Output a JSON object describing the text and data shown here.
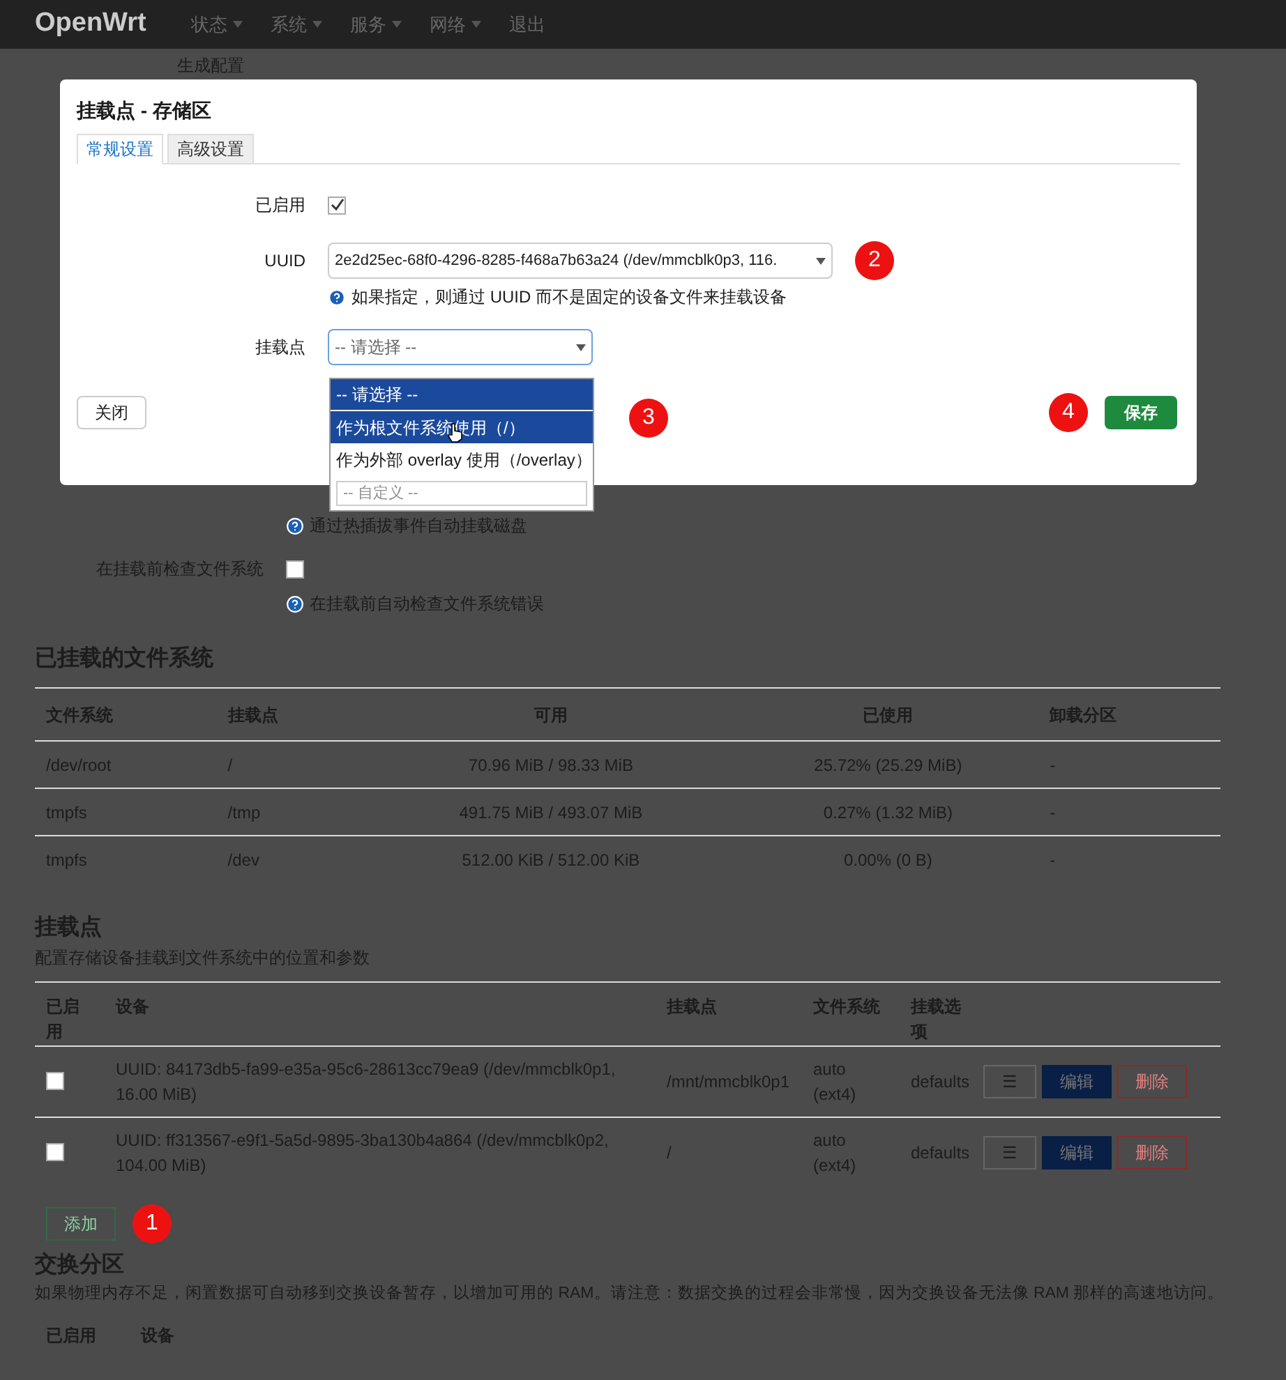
{
  "navbar": {
    "brand": "OpenWrt",
    "menus": [
      {
        "label": "状态",
        "dropdown": true
      },
      {
        "label": "系统",
        "dropdown": true
      },
      {
        "label": "服务",
        "dropdown": true
      },
      {
        "label": "网络",
        "dropdown": true
      },
      {
        "label": "退出",
        "dropdown": false
      }
    ]
  },
  "background_form": {
    "top_label": "生成配置",
    "hotplug_hint": "通过热插拔事件自动挂载磁盘",
    "check_label": "在挂载前检查文件系统",
    "check_checked": false,
    "check_hint": "在挂载前自动检查文件系统错误"
  },
  "mounted_fs": {
    "title": "已挂载的文件系统",
    "columns": [
      "文件系统",
      "挂载点",
      "可用",
      "已使用",
      "卸载分区"
    ],
    "rows": [
      [
        "/dev/root",
        "/",
        "70.96 MiB / 98.33 MiB",
        "25.72% (25.29 MiB)",
        "-"
      ],
      [
        "tmpfs",
        "/tmp",
        "491.75 MiB / 493.07 MiB",
        "0.27% (1.32 MiB)",
        "-"
      ],
      [
        "tmpfs",
        "/dev",
        "512.00 KiB / 512.00 KiB",
        "0.00% (0 B)",
        "-"
      ]
    ]
  },
  "mount_points": {
    "title": "挂载点",
    "description": "配置存储设备挂载到文件系统中的位置和参数",
    "columns": [
      "已启用",
      "设备",
      "挂载点",
      "文件系统",
      "挂载选项"
    ],
    "rows": [
      {
        "enabled": false,
        "device": "UUID: 84173db5-fa99-e35a-95c6-28613cc79ea9 (/dev/mmcblk0p1, 16.00 MiB)",
        "mount": "/mnt/mmcblk0p1",
        "fs": "auto (ext4)",
        "options": "defaults",
        "menu": "☰",
        "edit": "编辑",
        "delete": "删除"
      },
      {
        "enabled": false,
        "device": "UUID: ff313567-e9f1-5a5d-9895-3ba130b4a864 (/dev/mmcblk0p2, 104.00 MiB)",
        "mount": "/",
        "fs": "auto (ext4)",
        "options": "defaults",
        "menu": "☰",
        "edit": "编辑",
        "delete": "删除"
      }
    ],
    "add_button": "添加"
  },
  "swap": {
    "title": "交换分区",
    "description": "如果物理内存不足，闲置数据可自动移到交换设备暂存，以增加可用的 RAM。请注意：数据交换的过程会非常慢，因为交换设备无法像 RAM 那样的高速地访问。",
    "columns": [
      "已启用",
      "设备"
    ]
  },
  "modal": {
    "title": "挂载点 - 存储区",
    "tabs": [
      {
        "label": "常规设置",
        "selected": true
      },
      {
        "label": "高级设置",
        "selected": false
      }
    ],
    "enabled_label": "已启用",
    "enabled_checked": true,
    "uuid_label": "UUID",
    "uuid_value": "2e2d25ec-68f0-4296-8285-f468a7b63a24 (/dev/mmcblk0p3, 116.",
    "uuid_hint": "如果指定，则通过 UUID 而不是固定的设备文件来挂载设备",
    "mount_label": "挂载点",
    "mount_placeholder": "-- 请选择 --",
    "options": [
      {
        "kind": "option",
        "label": "-- 请选择 --",
        "selected": true,
        "hovered": false
      },
      {
        "kind": "option",
        "label": "作为根文件系统使用（/）",
        "selected": false,
        "hovered": true
      },
      {
        "kind": "option",
        "label": "作为外部 overlay 使用（/overlay）",
        "selected": false,
        "hovered": false
      },
      {
        "kind": "input",
        "placeholder": "-- 自定义 --"
      }
    ],
    "close_button": "关闭",
    "save_button": "保存"
  },
  "annotations": [
    "1",
    "2",
    "3",
    "4"
  ]
}
